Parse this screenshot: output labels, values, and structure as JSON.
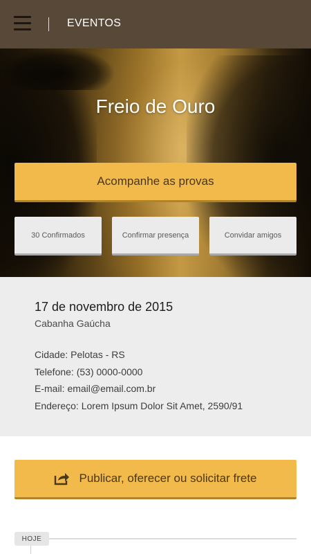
{
  "header": {
    "title": "EVENTOS",
    "menu_icon": "hamburger-menu-icon"
  },
  "event": {
    "title": "Freio de Ouro",
    "primary_action": "Acompanhe as provas",
    "confirmed": "30 Confirmados",
    "confirm_presence": "Confirmar presença",
    "invite_friends": "Convidar amigos"
  },
  "info": {
    "date": "17 de novembro de 2015",
    "venue": "Cabanha Gaúcha",
    "city": "Cidade: Pelotas - RS",
    "phone": "Telefone: (53) 0000-0000",
    "email": "E-mail: email@email.com.br",
    "address": "Endereço: Lorem Ipsum Dolor Sit Amet, 2590/91"
  },
  "publish": {
    "label": "Publicar, oferecer ou solicitar frete",
    "icon": "share-icon"
  },
  "timeline": {
    "today_label": "HOJE"
  },
  "colors": {
    "topbar": "#574838",
    "accent": "#f2b94b",
    "info_bg": "#ededed"
  }
}
